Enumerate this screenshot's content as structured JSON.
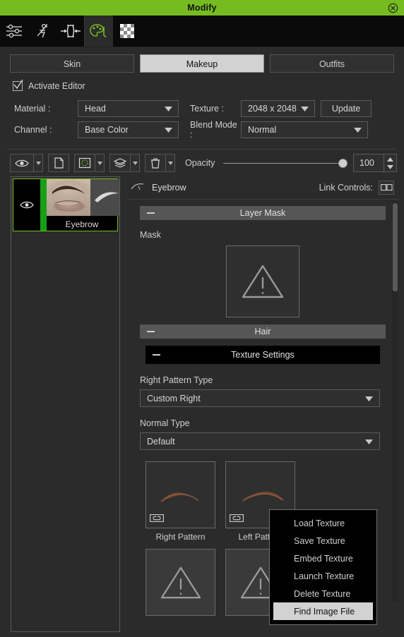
{
  "window": {
    "title": "Modify",
    "close_icon": "close-circle-icon",
    "accent_color": "#76bc21"
  },
  "icon_toolbar": {
    "items": [
      {
        "name": "sliders-icon",
        "label": "Adjust"
      },
      {
        "name": "pose-figure-icon",
        "label": "Pose"
      },
      {
        "name": "constrain-icon",
        "label": "Constrain"
      },
      {
        "name": "palette-icon",
        "label": "Appearance Editor",
        "active": true
      },
      {
        "name": "checkerboard-icon",
        "label": "Texture"
      }
    ]
  },
  "tabs": [
    {
      "label": "Skin",
      "selected": false
    },
    {
      "label": "Makeup",
      "selected": true
    },
    {
      "label": "Outfits",
      "selected": false
    }
  ],
  "activate_editor": {
    "label": "Activate Editor",
    "checked": true
  },
  "form": {
    "material_label": "Material :",
    "material_value": "Head",
    "texture_label": "Texture :",
    "texture_value": "2048 x 2048",
    "update_label": "Update",
    "channel_label": "Channel :",
    "channel_value": "Base Color",
    "blend_label": "Blend Mode :",
    "blend_value": "Normal"
  },
  "layer_toolbar": {
    "buttons": [
      {
        "name": "visibility-eye-icon",
        "label": "Visibility"
      },
      {
        "name": "duplicate-layer-icon",
        "label": "Duplicate Layer"
      },
      {
        "name": "layer-mask-icon",
        "label": "Add Mask"
      },
      {
        "name": "merge-layers-icon",
        "label": "Merge Layers"
      },
      {
        "name": "delete-layer-icon",
        "label": "Delete Layer"
      }
    ],
    "opacity_label": "Opacity",
    "opacity_value": "100",
    "opacity_percent": 100
  },
  "layer_list": {
    "items": [
      {
        "name": "Eyebrow",
        "selected": true,
        "visible": true
      }
    ]
  },
  "properties": {
    "header_icon": "eyebrow-icon",
    "header_title": "Eyebrow",
    "link_controls_label": "Link Controls:",
    "link_controls_icon": "link-controls-icon",
    "layer_mask_section": "Layer Mask",
    "mask_label": "Mask",
    "mask_thumbnail_icon": "warning-triangle-icon",
    "hair_section": "Hair",
    "texture_settings_section": "Texture Settings",
    "right_pattern_type_label": "Right Pattern Type",
    "right_pattern_type_value": "Custom Right",
    "normal_type_label": "Normal Type",
    "normal_type_value": "Default",
    "patterns": [
      {
        "caption": "Right Pattern",
        "link_icon": "chain-link-icon"
      },
      {
        "caption": "Left Pattern",
        "link_icon": "chain-link-icon"
      }
    ],
    "pattern_placeholders": [
      {
        "icon": "warning-triangle-icon"
      },
      {
        "icon": "warning-triangle-icon"
      }
    ]
  },
  "context_menu": {
    "items": [
      {
        "label": "Load Texture",
        "highlighted": false
      },
      {
        "label": "Save Texture",
        "highlighted": false
      },
      {
        "label": "Embed Texture",
        "highlighted": false
      },
      {
        "label": "Launch Texture",
        "highlighted": false
      },
      {
        "label": "Delete Texture",
        "highlighted": false
      },
      {
        "label": "Find Image File",
        "highlighted": true
      }
    ]
  }
}
